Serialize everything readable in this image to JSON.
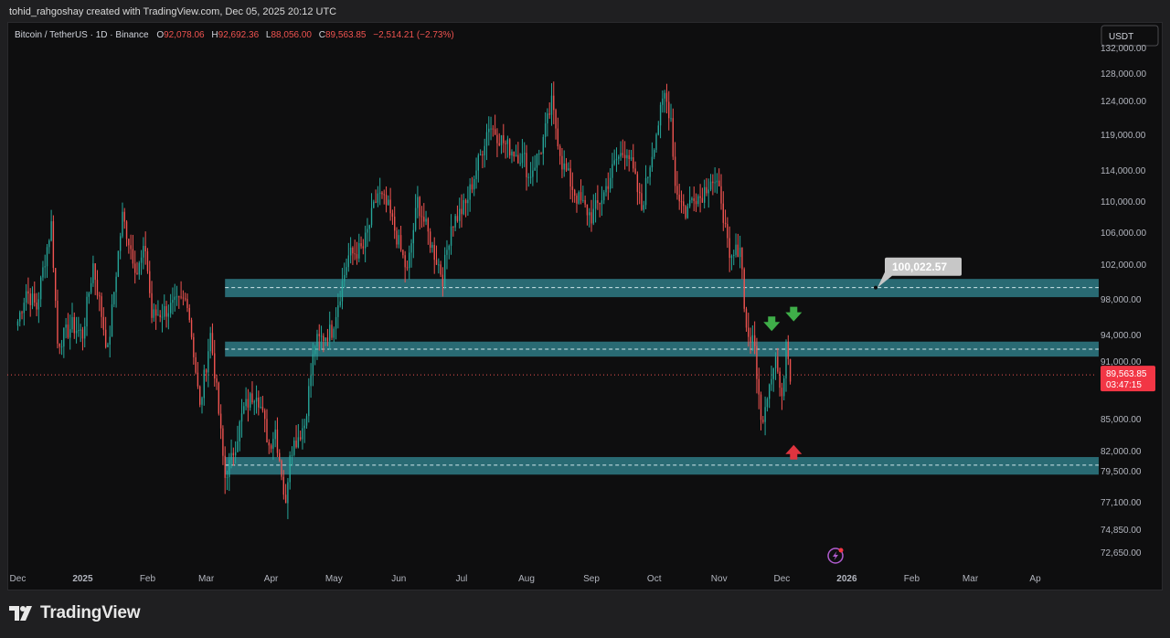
{
  "header": {
    "attribution": "tohid_rahgoshay created with TradingView.com, Dec 05, 2025 20:12 UTC"
  },
  "legend": {
    "symbol": "Bitcoin / TetherUS · 1D · Binance",
    "o_label": "O",
    "o_value": "92,078.06",
    "h_label": "H",
    "h_value": "92,692.36",
    "l_label": "L",
    "l_value": "88,056.00",
    "c_label": "C",
    "c_value": "89,563.85",
    "change": "−2,514.21 (−2.73%)"
  },
  "currency_button": "USDT",
  "price_badge": {
    "price": "89,563.85",
    "countdown": "03:47:15"
  },
  "callout": {
    "label": "100,022.57"
  },
  "branding": {
    "name": "TradingView"
  },
  "colors": {
    "up": "#26a69a",
    "down": "#ef5350",
    "zone": "#2e7a85",
    "zone_line": "#cfe6ea",
    "arrow_up": "#e0343f",
    "arrow_down": "#3fae49",
    "background": "#0e0e0f"
  },
  "icons": {
    "flash": "flash-icon",
    "arrow_down": "arrow-down-icon",
    "arrow_up": "arrow-up-icon",
    "logo": "tradingview-logo-icon"
  },
  "chart_data": {
    "type": "candlestick",
    "symbol": "BTCUSDT",
    "interval": "1D",
    "y_ticks": [
      "72,650.00",
      "74,850.00",
      "77,100.00",
      "79,500.00",
      "82,000.00",
      "85,000.00",
      "91,000.00",
      "94,000.00",
      "98,000.00",
      "102,000.00",
      "106,000.00",
      "110,000.00",
      "114,000.00",
      "119,000.00",
      "124,000.00",
      "128,000.00",
      "132,000.00"
    ],
    "y_tick_values": [
      72650,
      74850,
      77100,
      79500,
      82000,
      85000,
      91000,
      94000,
      98000,
      102000,
      106000,
      110000,
      114000,
      119000,
      124000,
      128000,
      132000
    ],
    "x_ticks": [
      "Dec",
      "2025",
      "Feb",
      "Mar",
      "Apr",
      "May",
      "Jun",
      "Jul",
      "Aug",
      "Sep",
      "Oct",
      "Nov",
      "Dec",
      "2026",
      "Feb",
      "Mar",
      "Ap"
    ],
    "x_tick_dates": [
      "2024-12-01",
      "2025-01-01",
      "2025-02-01",
      "2025-03-01",
      "2025-04-01",
      "2025-05-01",
      "2025-06-01",
      "2025-07-01",
      "2025-08-01",
      "2025-09-01",
      "2025-10-01",
      "2025-11-01",
      "2025-12-01",
      "2026-01-01",
      "2026-02-01",
      "2026-03-01",
      "2026-04-01"
    ],
    "ylim": [
      72000,
      133000
    ],
    "last_price": 89563.85,
    "zones": [
      {
        "low": 98200,
        "high": 100300,
        "from": "2025-03-10",
        "to": "2026-04-30",
        "midline": 99300
      },
      {
        "low": 91500,
        "high": 93200,
        "from": "2025-03-10",
        "to": "2026-04-30",
        "midline": 92350
      },
      {
        "low": 79200,
        "high": 81200,
        "from": "2025-03-10",
        "to": "2026-04-30",
        "midline": 80200
      }
    ],
    "callout_price": 100022.57,
    "arrows": [
      {
        "date": "2025-11-27",
        "price": 95200,
        "direction": "down"
      },
      {
        "date": "2025-12-04",
        "price": 96300,
        "direction": "down"
      },
      {
        "date": "2025-12-04",
        "price": 81800,
        "direction": "up"
      }
    ],
    "anchors": [
      [
        "2024-12-01",
        95500
      ],
      [
        "2024-12-05",
        99000
      ],
      [
        "2024-12-10",
        97000
      ],
      [
        "2024-12-17",
        107000
      ],
      [
        "2024-12-20",
        93000
      ],
      [
        "2024-12-27",
        95000
      ],
      [
        "2025-01-01",
        94000
      ],
      [
        "2025-01-06",
        102000
      ],
      [
        "2025-01-13",
        92000
      ],
      [
        "2025-01-20",
        108000
      ],
      [
        "2025-01-27",
        101000
      ],
      [
        "2025-01-31",
        104000
      ],
      [
        "2025-02-03",
        96000
      ],
      [
        "2025-02-12",
        97000
      ],
      [
        "2025-02-20",
        98000
      ],
      [
        "2025-02-26",
        86000
      ],
      [
        "2025-03-03",
        94000
      ],
      [
        "2025-03-05",
        90000
      ],
      [
        "2025-03-10",
        79000
      ],
      [
        "2025-03-13",
        81000
      ],
      [
        "2025-03-19",
        86000
      ],
      [
        "2025-03-25",
        88000
      ],
      [
        "2025-03-31",
        82500
      ],
      [
        "2025-04-03",
        84000
      ],
      [
        "2025-04-08",
        76500
      ],
      [
        "2025-04-10",
        82000
      ],
      [
        "2025-04-17",
        84500
      ],
      [
        "2025-04-22",
        93000
      ],
      [
        "2025-04-30",
        94500
      ],
      [
        "2025-05-08",
        103000
      ],
      [
        "2025-05-15",
        104000
      ],
      [
        "2025-05-22",
        111000
      ],
      [
        "2025-05-27",
        109000
      ],
      [
        "2025-06-05",
        101000
      ],
      [
        "2025-06-10",
        110000
      ],
      [
        "2025-06-17",
        104000
      ],
      [
        "2025-06-22",
        100500
      ],
      [
        "2025-06-26",
        107000
      ],
      [
        "2025-07-03",
        109500
      ],
      [
        "2025-07-10",
        116000
      ],
      [
        "2025-07-14",
        120500
      ],
      [
        "2025-07-22",
        117500
      ],
      [
        "2025-07-31",
        115500
      ],
      [
        "2025-08-02",
        113000
      ],
      [
        "2025-08-08",
        117000
      ],
      [
        "2025-08-13",
        123500
      ],
      [
        "2025-08-18",
        115000
      ],
      [
        "2025-08-25",
        110500
      ],
      [
        "2025-09-01",
        108000
      ],
      [
        "2025-09-07",
        111000
      ],
      [
        "2025-09-13",
        115500
      ],
      [
        "2025-09-18",
        117000
      ],
      [
        "2025-09-25",
        109000
      ],
      [
        "2025-10-01",
        118000
      ],
      [
        "2025-10-06",
        124800
      ],
      [
        "2025-10-09",
        121500
      ],
      [
        "2025-10-11",
        112000
      ],
      [
        "2025-10-16",
        108500
      ],
      [
        "2025-10-20",
        111000
      ],
      [
        "2025-10-23",
        110500
      ],
      [
        "2025-10-28",
        113000
      ],
      [
        "2025-11-02",
        110500
      ],
      [
        "2025-11-06",
        102000
      ],
      [
        "2025-11-11",
        104500
      ],
      [
        "2025-11-14",
        94500
      ],
      [
        "2025-11-18",
        92500
      ],
      [
        "2025-11-21",
        84500
      ],
      [
        "2025-11-26",
        90000
      ],
      [
        "2025-11-28",
        91500
      ],
      [
        "2025-12-01",
        86500
      ],
      [
        "2025-12-03",
        93500
      ],
      [
        "2025-12-04",
        92078
      ],
      [
        "2025-12-05",
        89563.85
      ]
    ]
  }
}
